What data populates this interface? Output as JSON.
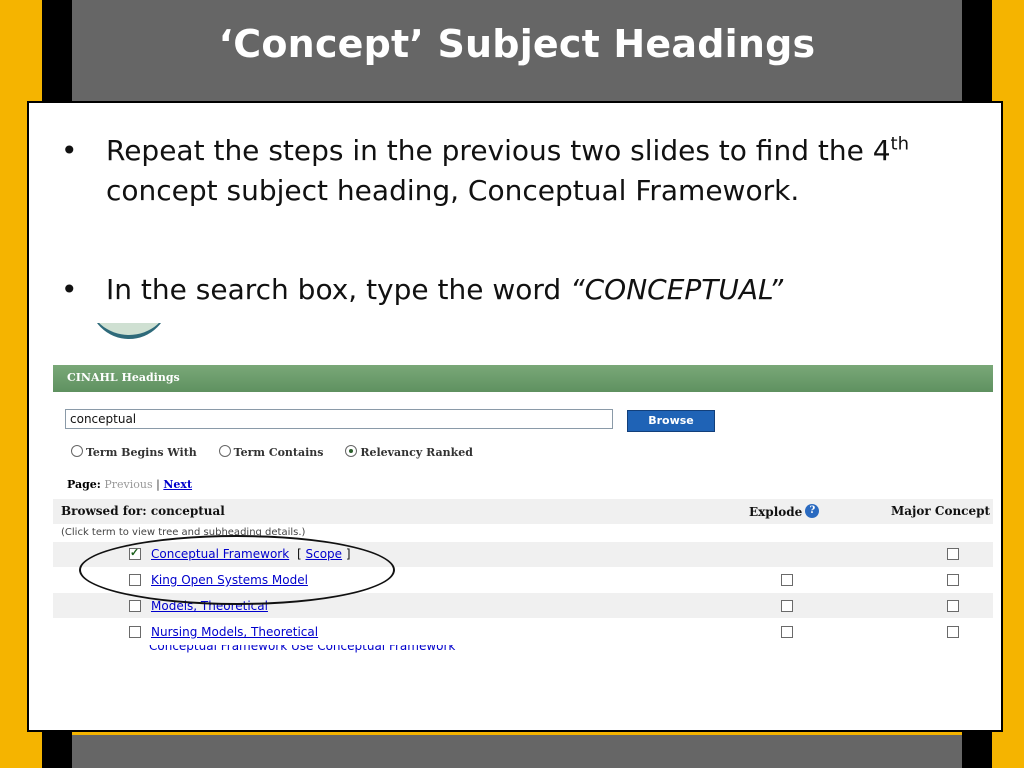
{
  "slide": {
    "title": "‘Concept’ Subject Headings",
    "bullet1_text": "Repeat the steps in the previous two slides to find the 4",
    "bullet1_sup": "th",
    "bullet1_tail": "concept subject heading, Conceptual Framework.",
    "bullet2_text": "In the search box, type the word ",
    "bullet2_em": "“CONCEPTUAL”"
  },
  "cinahl": {
    "section_label": "CINAHL  Headings",
    "search_value": "conceptual",
    "browse_label": "Browse",
    "radios": [
      {
        "label": "Term Begins With",
        "selected": false
      },
      {
        "label": "Term Contains",
        "selected": false
      },
      {
        "label": "Relevancy Ranked",
        "selected": true
      }
    ],
    "page_label": "Page:",
    "prev_label": "Previous",
    "separator": "|",
    "next_label": "Next",
    "browsed_for": "Browsed for: conceptual",
    "explode_label": "Explode",
    "help_icon": "?",
    "major_concept_label": "Major Concept",
    "hint": "(Click term to view tree and subheading details.)",
    "terms": [
      {
        "label": "Conceptual Framework",
        "checked": true,
        "scope_label": "Scope",
        "explode": false,
        "major": false
      },
      {
        "label": "King Open Systems Model",
        "checked": false,
        "explode": false,
        "major": false
      },
      {
        "label": "Models, Theoretical",
        "checked": false,
        "explode": false,
        "major": false
      },
      {
        "label": "Nursing Models, Theoretical",
        "checked": false,
        "explode": false,
        "major": false
      }
    ],
    "cut_off_row": "Conceptual Framework  Use  Conceptual Framework"
  },
  "colors": {
    "frame": "#f5b400",
    "title_bar": "#666666",
    "cinahl_bar": "#6a9a68",
    "browse_button": "#1f63b6",
    "link": "#0000cc"
  }
}
